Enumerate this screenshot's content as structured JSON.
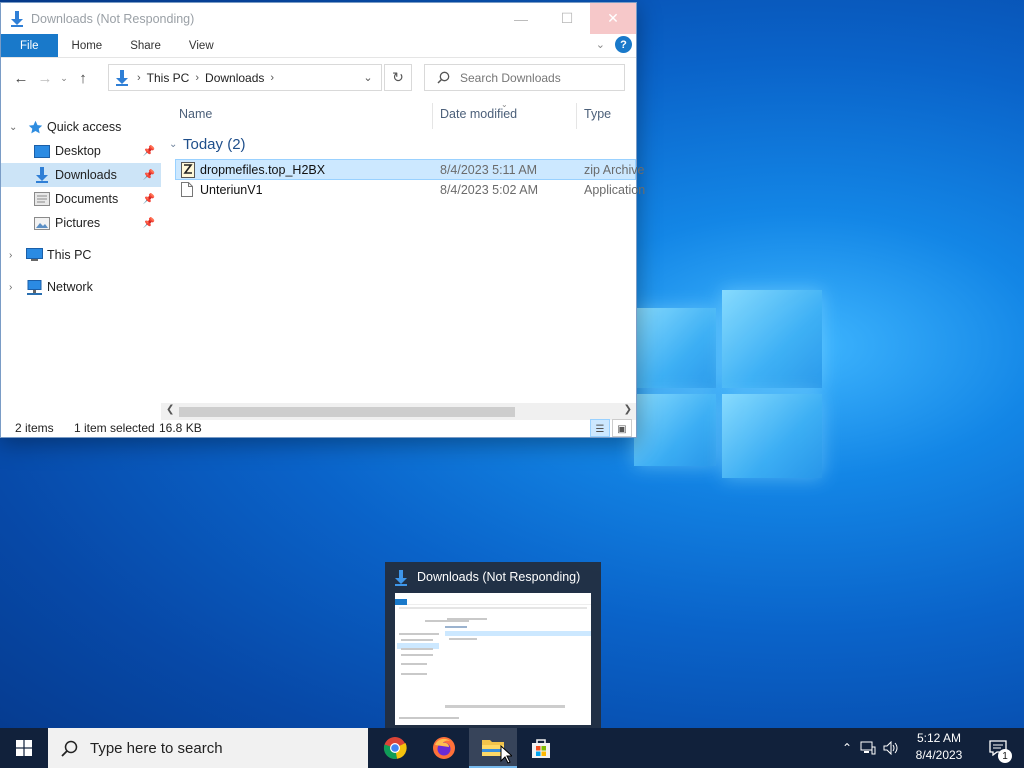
{
  "window": {
    "title": "Downloads (Not Responding)"
  },
  "ribbon": {
    "tabs": [
      "File",
      "Home",
      "Share",
      "View"
    ],
    "help": "?"
  },
  "address": {
    "crumbs": [
      "This PC",
      "Downloads"
    ],
    "search_placeholder": "Search Downloads"
  },
  "sidebar": {
    "items": [
      {
        "label": "Quick access",
        "icon": "star-icon"
      },
      {
        "label": "Desktop",
        "icon": "desktop-folder-icon"
      },
      {
        "label": "Downloads",
        "icon": "downloads-icon"
      },
      {
        "label": "Documents",
        "icon": "documents-icon"
      },
      {
        "label": "Pictures",
        "icon": "pictures-icon"
      },
      {
        "label": "This PC",
        "icon": "computer-icon"
      },
      {
        "label": "Network",
        "icon": "network-icon"
      }
    ]
  },
  "columns": [
    "Name",
    "Date modified",
    "Type"
  ],
  "group": {
    "label": "Today (2)"
  },
  "files": [
    {
      "name": "dropmefiles.top_H2BX",
      "date": "8/4/2023 5:11 AM",
      "type": "zip Archive",
      "icon": "zip-file-icon"
    },
    {
      "name": "UnteriunV1",
      "date": "8/4/2023 5:02 AM",
      "type": "Application",
      "icon": "file-icon"
    }
  ],
  "status": {
    "count": "2 items",
    "selected": "1 item selected",
    "size": "16.8 KB"
  },
  "preview": {
    "title": "Downloads (Not Responding)"
  },
  "taskbar": {
    "search_placeholder": "Type here to search",
    "time": "5:12 AM",
    "date": "8/4/2023",
    "notifications": "1"
  },
  "colors": {
    "accent": "#1979ca",
    "selection": "#cce8ff",
    "taskbar": "#11213b"
  }
}
